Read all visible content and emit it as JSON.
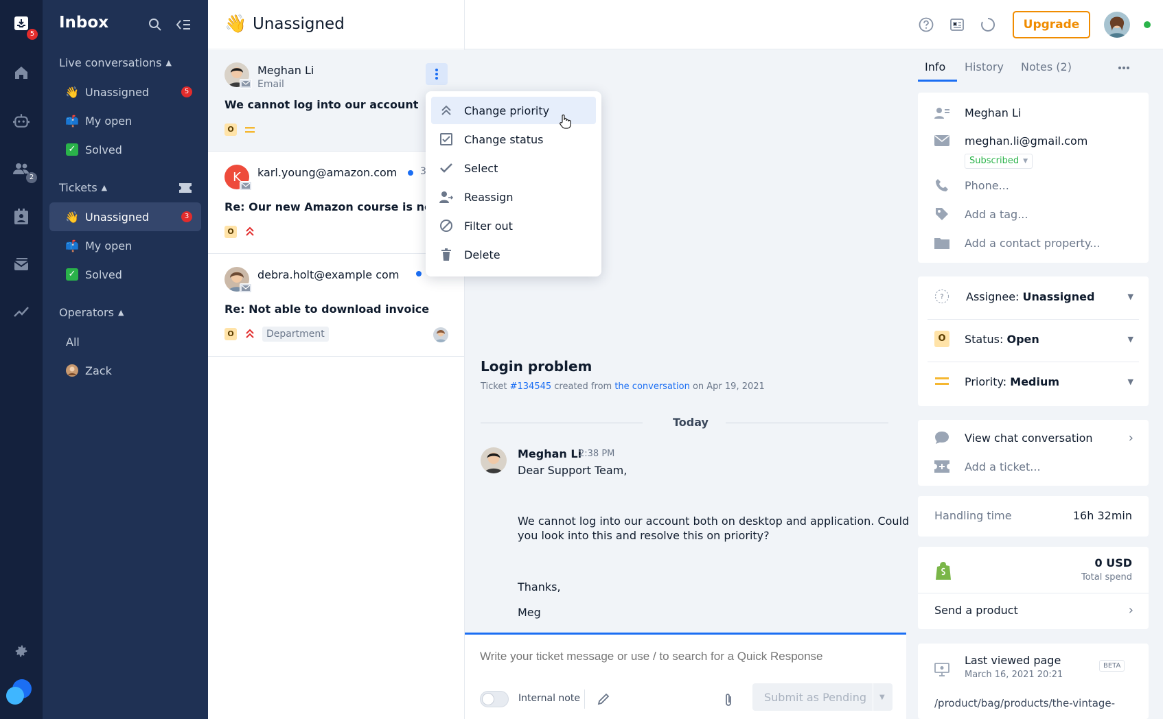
{
  "rail": {
    "inbox_badge": "5",
    "team_badge": "2"
  },
  "sidebar": {
    "title": "Inbox",
    "live": {
      "heading": "Live conversations",
      "items": [
        {
          "label": "Unassigned",
          "badge": "5"
        },
        {
          "label": "My open"
        },
        {
          "label": "Solved"
        }
      ]
    },
    "tickets": {
      "heading": "Tickets",
      "items": [
        {
          "label": "Unassigned",
          "badge": "3"
        },
        {
          "label": "My open"
        },
        {
          "label": "Solved"
        }
      ]
    },
    "operators": {
      "heading": "Operators",
      "items": [
        {
          "label": "All"
        },
        {
          "label": "Zack"
        }
      ]
    }
  },
  "list": {
    "title": "Unassigned",
    "items": [
      {
        "name": "Meghan Li",
        "channel": "Email",
        "subject": "We cannot log into our account",
        "status": "O"
      },
      {
        "name": "karl.young@amazon.com",
        "channel": "Email",
        "subject": "Re: Our new Amazon course is now open",
        "status": "O",
        "time": "3",
        "initial": "K"
      },
      {
        "name": "debra.holt@example com",
        "channel": "Email",
        "subject": "Re: Not able to download invoice",
        "status": "O",
        "tag": "Department"
      }
    ]
  },
  "menu": {
    "items": [
      {
        "label": "Change priority"
      },
      {
        "label": "Change status"
      },
      {
        "label": "Select"
      },
      {
        "label": "Reassign"
      },
      {
        "label": "Filter out"
      },
      {
        "label": "Delete"
      }
    ]
  },
  "topbar": {
    "upgrade_label": "Upgrade"
  },
  "ticket": {
    "title": "Login problem",
    "meta_prefix": "Ticket",
    "ticket_id": "#134545",
    "meta_mid": "created from",
    "meta_link": "the conversation",
    "meta_suffix": "on Apr 19, 2021",
    "divider": "Today",
    "message": {
      "author": "Meghan Li",
      "time": "2:38 PM",
      "greeting": "Dear Support Team,",
      "body1": "We cannot log into our account both on desktop and application. Could",
      "body2": "you look into this and resolve this on priority?",
      "thanks": "Thanks,",
      "sign": "Meg"
    }
  },
  "composer": {
    "placeholder": "Write your ticket message or use / to search for a Quick Response",
    "internal_note": "Internal note",
    "submit": "Submit as Pending"
  },
  "right": {
    "tabs": [
      "Info",
      "History",
      "Notes (2)"
    ],
    "contact": {
      "name": "Meghan Li",
      "email": "meghan.li@gmail.com",
      "subscribed": "Subscribed",
      "phone": "Phone...",
      "tag": "Add a tag...",
      "property": "Add a contact property..."
    },
    "assignee_label": "Assignee:",
    "assignee_value": "Unassigned",
    "status_label": "Status:",
    "status_value": "Open",
    "status_badge": "O",
    "priority_label": "Priority:",
    "priority_value": "Medium",
    "view_chat": "View chat conversation",
    "add_ticket": "Add a ticket...",
    "handling_label": "Handling time",
    "handling_value": "16h 32min",
    "spend_value": "0 USD",
    "spend_label": "Total spend",
    "send_product": "Send a product",
    "last_viewed_label": "Last viewed page",
    "last_viewed_date": "March 16, 2021 20:21",
    "beta": "BETA",
    "last_viewed_url": "/product/bag/products/the-vintage-"
  },
  "colors": {
    "accent": "#1b6ef3",
    "upgrade": "#f08c00",
    "rail": "#14213d",
    "sidebar": "#1f3154"
  }
}
